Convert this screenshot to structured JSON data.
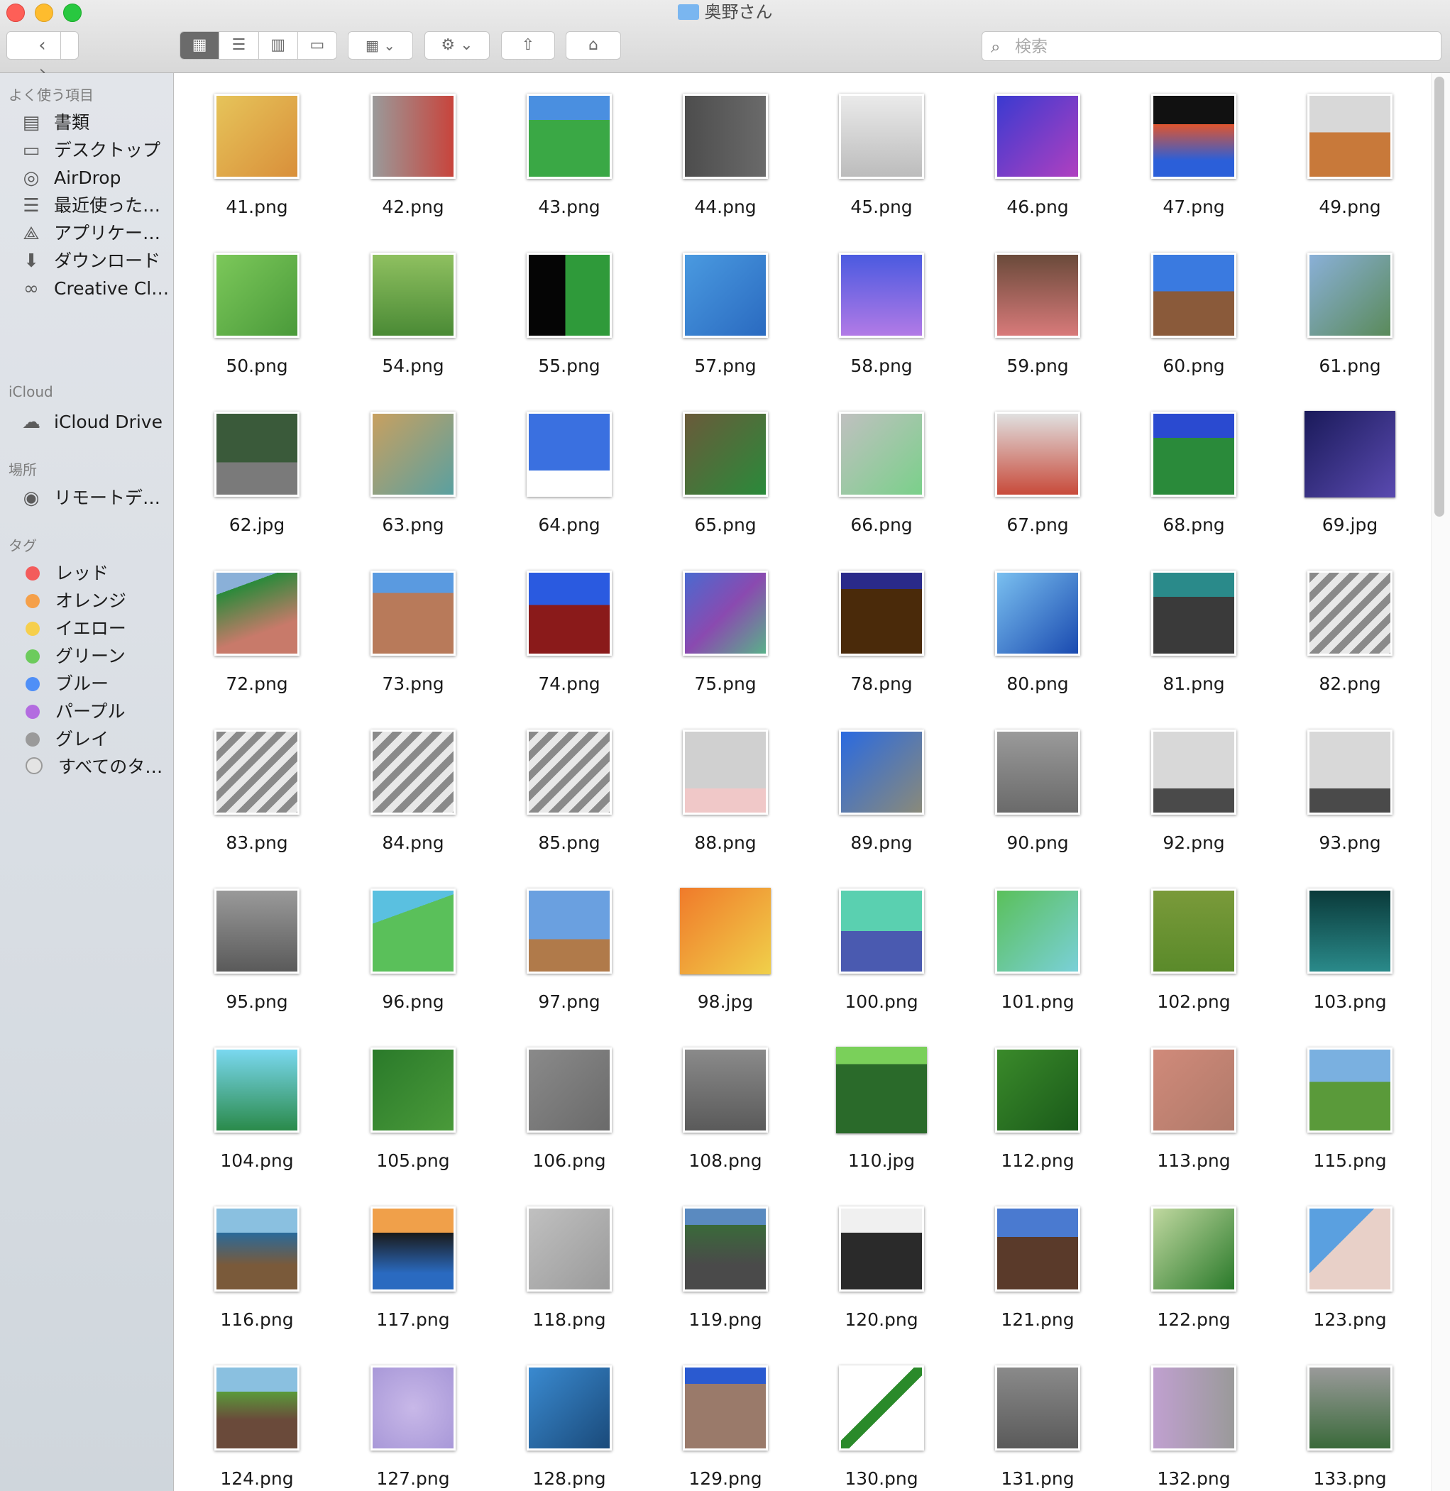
{
  "window": {
    "title": "奥野さん"
  },
  "toolbar": {
    "back": "‹",
    "forward": "›",
    "view_icons": [
      "grid-view-icon",
      "list-view-icon",
      "column-view-icon",
      "gallery-view-icon"
    ],
    "search_placeholder": "検索"
  },
  "sidebar": {
    "favorites_header": "よく使う項目",
    "favorites": [
      {
        "label": "書類",
        "icon": "document-icon",
        "glyph": "▤"
      },
      {
        "label": "デスクトップ",
        "icon": "desktop-icon",
        "glyph": "▭"
      },
      {
        "label": "AirDrop",
        "icon": "airdrop-icon",
        "glyph": "◎"
      },
      {
        "label": "最近使った…",
        "icon": "recents-icon",
        "glyph": "☰"
      },
      {
        "label": "アプリケー…",
        "icon": "applications-icon",
        "glyph": "⟁"
      },
      {
        "label": "ダウンロード",
        "icon": "download-icon",
        "glyph": "⬇"
      },
      {
        "label": "Creative Cl…",
        "icon": "creative-cloud-icon",
        "glyph": "∞"
      }
    ],
    "icloud_header": "iCloud",
    "icloud": [
      {
        "label": "iCloud Drive",
        "icon": "cloud-icon",
        "glyph": "☁"
      }
    ],
    "places_header": "場所",
    "places": [
      {
        "label": "リモートデ…",
        "icon": "remote-disc-icon",
        "glyph": "◉"
      }
    ],
    "tags_header": "タグ",
    "tags": [
      {
        "label": "レッド",
        "color": "#f35c5c"
      },
      {
        "label": "オレンジ",
        "color": "#f5a04a"
      },
      {
        "label": "イエロー",
        "color": "#f6cf4c"
      },
      {
        "label": "グリーン",
        "color": "#6ccb5c"
      },
      {
        "label": "ブルー",
        "color": "#4f8ff7"
      },
      {
        "label": "パープル",
        "color": "#b36ce0"
      },
      {
        "label": "グレイ",
        "color": "#9a9a9a"
      },
      {
        "label": "すべてのタ…",
        "color": "#d9d9d9"
      }
    ]
  },
  "files": [
    {
      "name": "41.png",
      "bg": "linear-gradient(135deg,#e6c45a,#d98f3a)"
    },
    {
      "name": "42.png",
      "bg": "linear-gradient(90deg,#9a9a9a,#c8443c)"
    },
    {
      "name": "43.png",
      "bg": "linear-gradient(180deg,#4a8fe0 30%,#3aa845 30%)"
    },
    {
      "name": "44.png",
      "bg": "linear-gradient(90deg,#4d4d4d,#6a6a6a)"
    },
    {
      "name": "45.png",
      "bg": "linear-gradient(180deg,#eaeaea,#bcbcbc)"
    },
    {
      "name": "46.png",
      "bg": "linear-gradient(135deg,#3a3ad0,#b040c0)"
    },
    {
      "name": "47.png",
      "bg": "linear-gradient(180deg,#111 35%,#e0552e 35%,#2b5fd9 80%)"
    },
    {
      "name": "49.png",
      "bg": "linear-gradient(180deg,#d8d8d8 45%,#c8793a 45%)"
    },
    {
      "name": "50.png",
      "bg": "linear-gradient(135deg,#7cc85a,#4a9a3a)"
    },
    {
      "name": "54.png",
      "bg": "linear-gradient(180deg,#8fc060,#4a8a35)"
    },
    {
      "name": "55.png",
      "bg": "linear-gradient(90deg,#050505 45%,#2f9a3a 45%)"
    },
    {
      "name": "57.png",
      "bg": "linear-gradient(135deg,#4a9ae0,#2a6ac0)"
    },
    {
      "name": "58.png",
      "bg": "linear-gradient(180deg,#4a5ae0,#b27ae6)"
    },
    {
      "name": "59.png",
      "bg": "linear-gradient(180deg,#6a4a3a,#d87a7a)"
    },
    {
      "name": "60.png",
      "bg": "linear-gradient(180deg,#3a7ae0 45%,#8a5a3a 45%)"
    },
    {
      "name": "61.png",
      "bg": "linear-gradient(135deg,#8ab0d8,#5a8a5a)"
    },
    {
      "name": "62.jpg",
      "bg": "linear-gradient(180deg,#3a5a3a 60%,#7a7a7a 60%)"
    },
    {
      "name": "63.png",
      "bg": "linear-gradient(135deg,#c8a060,#5aa0a0)"
    },
    {
      "name": "64.png",
      "bg": "linear-gradient(180deg,#3a70e0 70%,#ffffff 70%)"
    },
    {
      "name": "65.png",
      "bg": "linear-gradient(135deg,#6a5a3a,#2a8a3a)"
    },
    {
      "name": "66.png",
      "bg": "linear-gradient(135deg,#c0c0c0,#7ad08a)"
    },
    {
      "name": "67.png",
      "bg": "linear-gradient(180deg,#e0e0e0,#c84a3a)"
    },
    {
      "name": "68.png",
      "bg": "linear-gradient(180deg,#2a4ad0 30%,#2a8a3a 30%)"
    },
    {
      "name": "69.jpg",
      "bg": "linear-gradient(135deg,#1a1a5a,#5a4ab0)",
      "big": true
    },
    {
      "name": "72.png",
      "bg": "linear-gradient(160deg,#8ab0d8 20%,#2a8a3a 20%,#c87a6a 70%)"
    },
    {
      "name": "73.png",
      "bg": "linear-gradient(180deg,#5a9ae0 25%,#b87a5a 25%)"
    },
    {
      "name": "74.png",
      "bg": "linear-gradient(180deg,#2a5ae0 40%,#8a1a1a 40%)"
    },
    {
      "name": "75.png",
      "bg": "linear-gradient(135deg,#4a6ad0,#8a4ab0,#5ab08a)"
    },
    {
      "name": "78.png",
      "bg": "linear-gradient(180deg,#2a2a8a 20%,#4a2a0a 20%)"
    },
    {
      "name": "80.png",
      "bg": "linear-gradient(135deg,#7ac0f0,#1a4ab0)"
    },
    {
      "name": "81.png",
      "bg": "linear-gradient(180deg,#2a8a8a 30%,#3a3a3a 30%)"
    },
    {
      "name": "82.png",
      "bg": "repeating-linear-gradient(135deg,#8a8a8a 0 10px,#e8e8e8 10px 20px)"
    },
    {
      "name": "83.png",
      "bg": "repeating-linear-gradient(135deg,#8a8a8a 0 10px,#e8e8e8 10px 20px)"
    },
    {
      "name": "84.png",
      "bg": "repeating-linear-gradient(135deg,#8a8a8a 0 10px,#e8e8e8 10px 20px)"
    },
    {
      "name": "85.png",
      "bg": "repeating-linear-gradient(135deg,#8a8a8a 0 10px,#e8e8e8 10px 20px)"
    },
    {
      "name": "88.png",
      "bg": "linear-gradient(180deg,#d0d0d0 70%,#f0c8c8 70%)"
    },
    {
      "name": "89.png",
      "bg": "linear-gradient(135deg,#2a6ae0,#8a8a7a)"
    },
    {
      "name": "90.png",
      "bg": "linear-gradient(180deg,#9a9a9a,#6a6a6a)"
    },
    {
      "name": "92.png",
      "bg": "linear-gradient(180deg,#d8d8d8 70%,#4a4a4a 70%)"
    },
    {
      "name": "93.png",
      "bg": "linear-gradient(180deg,#d8d8d8 70%,#4a4a4a 70%)"
    },
    {
      "name": "95.png",
      "bg": "linear-gradient(180deg,#9a9a9a,#5a5a5a)"
    },
    {
      "name": "96.png",
      "bg": "linear-gradient(160deg,#5ac0e0 30%,#5ac05a 30%)"
    },
    {
      "name": "97.png",
      "bg": "linear-gradient(180deg,#6aa0e0 60%,#b07a4a 60%)"
    },
    {
      "name": "98.jpg",
      "bg": "linear-gradient(135deg,#f07a2a,#f0d04a)",
      "big": true
    },
    {
      "name": "100.png",
      "bg": "linear-gradient(180deg,#5ad0b0 50%,#4a5ab0 50%)"
    },
    {
      "name": "101.png",
      "bg": "linear-gradient(135deg,#5ac05a,#7ad0d8)"
    },
    {
      "name": "102.png",
      "bg": "linear-gradient(180deg,#7a9a3a,#5a8a2a)"
    },
    {
      "name": "103.png",
      "bg": "linear-gradient(180deg,#0a3a3a,#2a8a8a)"
    },
    {
      "name": "104.png",
      "bg": "linear-gradient(180deg,#7ad8f0,#2a8a4a)"
    },
    {
      "name": "105.png",
      "bg": "linear-gradient(135deg,#2a7a2a,#4a9a3a)"
    },
    {
      "name": "106.png",
      "bg": "linear-gradient(135deg,#8a8a8a,#6a6a6a)"
    },
    {
      "name": "108.png",
      "bg": "linear-gradient(180deg,#8a8a8a,#5a5a5a)"
    },
    {
      "name": "110.jpg",
      "bg": "linear-gradient(180deg,#7ad05a 20%,#2a6a2a 20%)",
      "big": true
    },
    {
      "name": "112.png",
      "bg": "linear-gradient(135deg,#3a8a2a,#1a5a1a)"
    },
    {
      "name": "113.png",
      "bg": "linear-gradient(135deg,#d08a7a,#b07a6a)"
    },
    {
      "name": "115.png",
      "bg": "linear-gradient(180deg,#7ab0e0 40%,#5a9a3a 40%)"
    },
    {
      "name": "116.png",
      "bg": "linear-gradient(180deg,#8ac0e0 30%,#2a6a9a 30%,#7a5a3a 70%)"
    },
    {
      "name": "117.png",
      "bg": "linear-gradient(180deg,#f0a04a 30%,#1a1a1a 30%,#2a6ac0 80%)"
    },
    {
      "name": "118.png",
      "bg": "linear-gradient(135deg,#c0c0c0,#9a9a9a)"
    },
    {
      "name": "119.png",
      "bg": "linear-gradient(180deg,#5a8ac0 20%,#3a6a3a 20%,#4a4a4a 70%)"
    },
    {
      "name": "120.png",
      "bg": "linear-gradient(180deg,#f0f0f0 30%,#2a2a2a 30%)"
    },
    {
      "name": "121.png",
      "bg": "linear-gradient(180deg,#4a7ad0 35%,#5a3a2a 35%)"
    },
    {
      "name": "122.png",
      "bg": "linear-gradient(135deg,#c0d8a0,#2a7a2a)"
    },
    {
      "name": "123.png",
      "bg": "linear-gradient(135deg,#5aa0e0 40%,#e8d0c8 40%)"
    },
    {
      "name": "124.png",
      "bg": "linear-gradient(180deg,#8ac0e0 30%,#5a9a3a 30%,#6a4a3a 65%)"
    },
    {
      "name": "127.png",
      "bg": "radial-gradient(circle,#c8b8e8,#a898d8)"
    },
    {
      "name": "128.png",
      "bg": "linear-gradient(135deg,#3a8ad0,#1a4a7a)"
    },
    {
      "name": "129.png",
      "bg": "linear-gradient(180deg,#2a5ad0 20%,#9a7a6a 20%)"
    },
    {
      "name": "130.png",
      "bg": "linear-gradient(135deg,#ffffff 45%,#2a8a2a 45%,#2a8a2a 55%,#ffffff 55%)"
    },
    {
      "name": "131.png",
      "bg": "linear-gradient(180deg,#8a8a8a,#5a5a5a)"
    },
    {
      "name": "132.png",
      "bg": "linear-gradient(90deg,#c0a0d0,#9a9a9a)"
    },
    {
      "name": "133.png",
      "bg": "linear-gradient(180deg,#9a9a9a,#3a6a3a)"
    }
  ]
}
